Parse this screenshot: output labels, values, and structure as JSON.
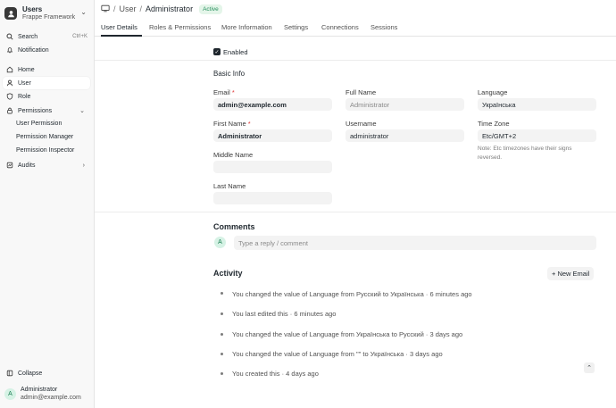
{
  "app": {
    "name": "Users",
    "subtitle": "Frappe Framework"
  },
  "sidebar": {
    "search_label": "Search",
    "search_shortcut": "Ctrl+K",
    "notification_label": "Notification",
    "items": [
      {
        "label": "Home"
      },
      {
        "label": "User"
      },
      {
        "label": "Role"
      },
      {
        "label": "Permissions"
      }
    ],
    "sub_items": [
      {
        "label": "User Permission"
      },
      {
        "label": "Permission Manager"
      },
      {
        "label": "Permission Inspector"
      }
    ],
    "audits_label": "Audits",
    "collapse_label": "Collapse",
    "user": {
      "initial": "A",
      "name": "Administrator",
      "email": "admin@example.com"
    }
  },
  "header": {
    "crumb_user": "User",
    "crumb_current": "Administrator",
    "status": "Active"
  },
  "tabs": [
    "User Details",
    "Roles & Permissions",
    "More Information",
    "Settings",
    "Connections",
    "Sessions"
  ],
  "form": {
    "enabled_label": "Enabled",
    "basic_info": "Basic Info",
    "email_label": "Email",
    "email_value": "admin@example.com",
    "first_name_label": "First Name",
    "first_name_value": "Administrator",
    "middle_name_label": "Middle Name",
    "middle_name_value": "",
    "last_name_label": "Last Name",
    "last_name_value": "",
    "full_name_label": "Full Name",
    "full_name_value": "Administrator",
    "username_label": "Username",
    "username_value": "administrator",
    "language_label": "Language",
    "language_value": "Українська",
    "timezone_label": "Time Zone",
    "timezone_value": "Etc/GMT+2",
    "timezone_note": "Note: Etc timezones have their signs reversed."
  },
  "comments": {
    "title": "Comments",
    "avatar": "A",
    "placeholder": "Type a reply / comment"
  },
  "activity": {
    "title": "Activity",
    "new_email": "+ New Email",
    "items": [
      "You changed the value of Language from Русский to Українська · 6 minutes ago",
      "You last edited this · 6 minutes ago",
      "You changed the value of Language from Українська to Русский · 3 days ago",
      "You changed the value of Language from \"\" to Українська · 3 days ago",
      "You created this · 4 days ago"
    ]
  }
}
